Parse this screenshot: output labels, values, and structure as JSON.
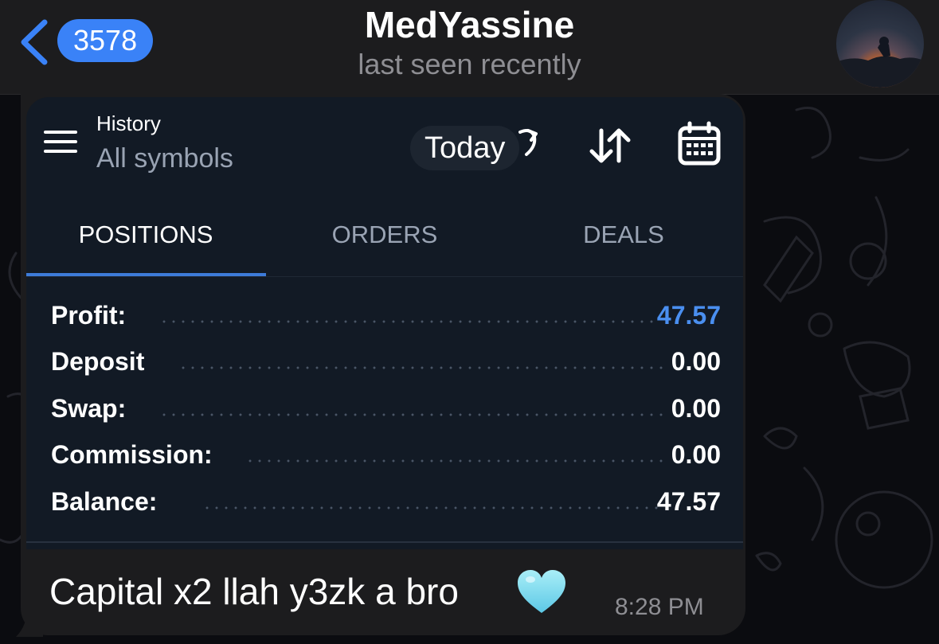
{
  "header": {
    "unread_count": "3578",
    "contact_name": "MedYassine",
    "status": "last seen recently"
  },
  "shot": {
    "history_title": "History",
    "history_subtitle": "All symbols",
    "period": "Today",
    "tabs": [
      "POSITIONS",
      "ORDERS",
      "DEALS"
    ],
    "active_tab": "POSITIONS",
    "accent_color": "#3d7bd9",
    "rows": [
      {
        "label": "Profit:",
        "value": "47.57"
      },
      {
        "label": "Deposit",
        "value": "0.00"
      },
      {
        "label": "Swap:",
        "value": "0.00"
      },
      {
        "label": "Commission:",
        "value": "0.00"
      },
      {
        "label": "Balance:",
        "value": "47.57"
      }
    ]
  },
  "message": {
    "text": "Capital x2 llah y3zk a bro",
    "emoji": "light-blue-heart",
    "time": "8:28 PM"
  },
  "icons": [
    "back-chevron-icon",
    "menu-icon",
    "refresh-icon",
    "sort-icon",
    "calendar-icon",
    "light-blue-heart-icon"
  ]
}
